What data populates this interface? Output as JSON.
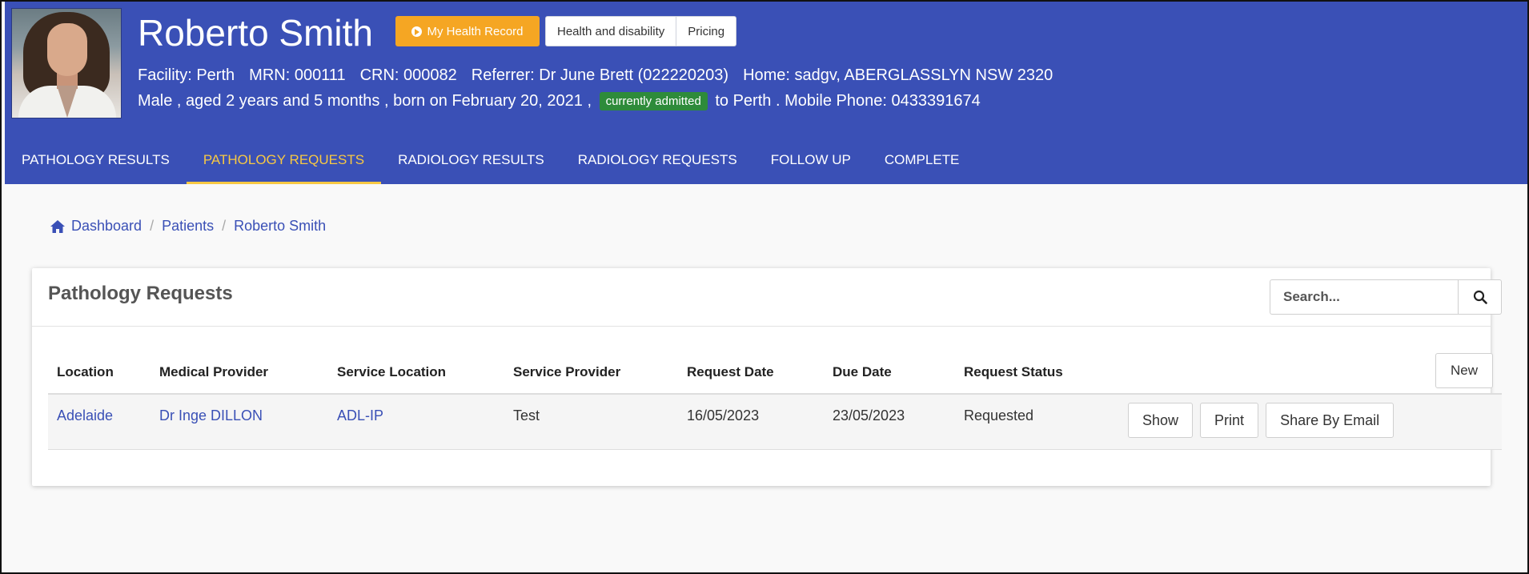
{
  "patient": {
    "name": "Roberto Smith",
    "health_record_label": "My Health Record",
    "header_buttons": [
      "Health and disability",
      "Pricing"
    ],
    "info_line1": {
      "facility": "Facility: Perth",
      "mrn": "MRN: 000111",
      "crn": "CRN: 000082",
      "referrer": "Referrer: Dr June Brett (022220203)",
      "home": "Home: sadgv, ABERGLASSLYN NSW 2320"
    },
    "info_line2": {
      "demographics": "Male , aged 2 years and 5 months , born on February 20, 2021 ,",
      "admitted_badge": "currently admitted",
      "location_phone": "to Perth . Mobile Phone: 0433391674"
    }
  },
  "tabs": [
    {
      "label": "PATHOLOGY RESULTS",
      "active": false
    },
    {
      "label": "PATHOLOGY REQUESTS",
      "active": true
    },
    {
      "label": "RADIOLOGY RESULTS",
      "active": false
    },
    {
      "label": "RADIOLOGY REQUESTS",
      "active": false
    },
    {
      "label": "FOLLOW UP",
      "active": false
    },
    {
      "label": "COMPLETE",
      "active": false
    }
  ],
  "breadcrumb": [
    "Dashboard",
    "Patients",
    "Roberto Smith"
  ],
  "panel": {
    "title": "Pathology Requests",
    "search_placeholder": "Search...",
    "new_label": "New"
  },
  "table": {
    "headers": [
      "Location",
      "Medical Provider",
      "Service Location",
      "Service Provider",
      "Request Date",
      "Due Date",
      "Request Status"
    ],
    "rows": [
      {
        "location": "Adelaide",
        "medical_provider": "Dr Inge DILLON",
        "service_location": "ADL-IP",
        "service_provider": "Test",
        "request_date": "16/05/2023",
        "due_date": "23/05/2023",
        "status": "Requested",
        "actions": [
          "Show",
          "Print",
          "Share By Email"
        ]
      }
    ]
  },
  "colors": {
    "header_bg": "#3a50b6",
    "accent_orange": "#f5a623",
    "active_tab": "#f7c843",
    "admitted_green": "#2e8b3a"
  }
}
